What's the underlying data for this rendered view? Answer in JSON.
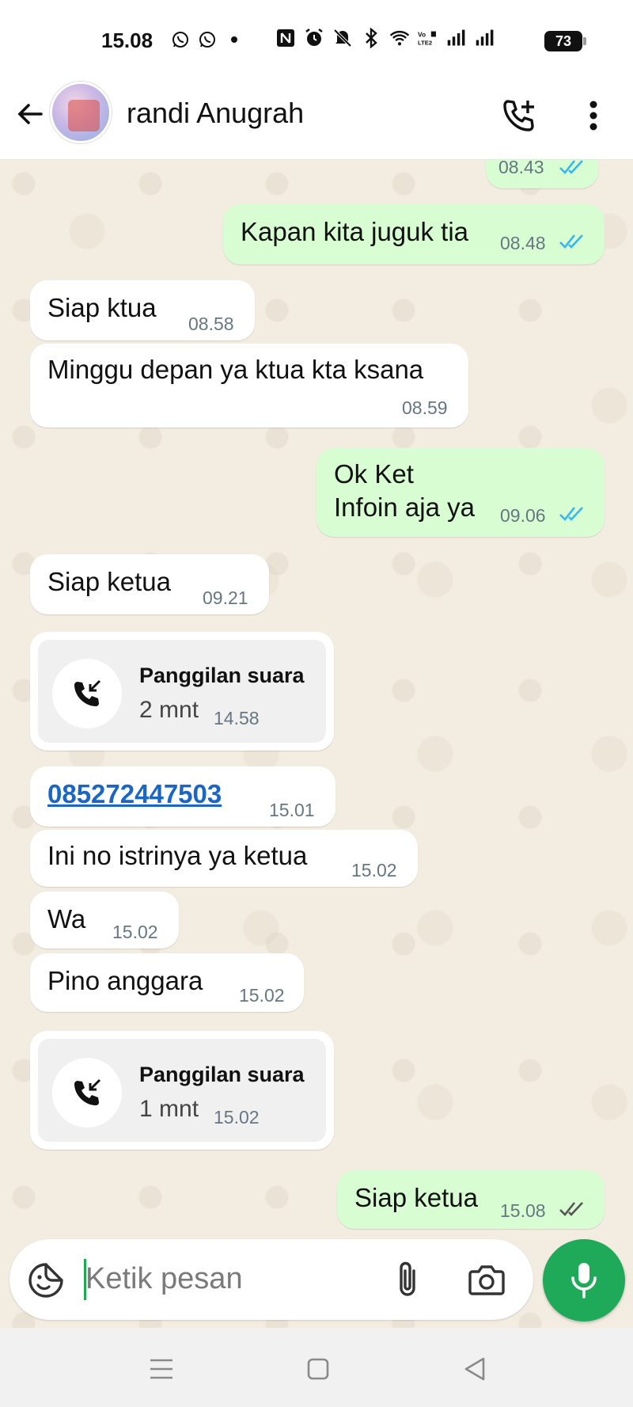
{
  "status_bar": {
    "time": "15.08",
    "battery": "73",
    "left_icons": [
      "whatsapp-icon",
      "whatsapp-icon",
      "dot-icon"
    ],
    "right_icons": [
      "nfc-icon",
      "alarm-icon",
      "mute-icon",
      "bluetooth-icon",
      "wifi-icon",
      "volte-icon",
      "signal-icon",
      "signal-icon"
    ]
  },
  "header": {
    "contact_name": "randi Anugrah",
    "icons": [
      "back-arrow-icon",
      "avatar",
      "add-call-icon",
      "more-vert-icon"
    ]
  },
  "messages": [
    {
      "dir": "out",
      "text": "",
      "time": "08.43",
      "read": true
    },
    {
      "dir": "out",
      "text": "Kapan kita juguk tia",
      "time": "08.48",
      "read": true
    },
    {
      "dir": "in",
      "text": "Siap ktua",
      "time": "08.58"
    },
    {
      "dir": "in",
      "text": "Minggu depan ya ktua kta ksana",
      "time": "08.59"
    },
    {
      "dir": "out",
      "text_line1": "Ok Ket",
      "text_line2": "Infoin aja ya",
      "time": "09.06",
      "read": true
    },
    {
      "dir": "in",
      "text": "Siap ketua",
      "time": "09.21"
    },
    {
      "dir": "in",
      "type": "call",
      "title": "Panggilan suara",
      "duration": "2 mnt",
      "time": "14.58"
    },
    {
      "dir": "in",
      "type": "link",
      "text": "085272447503",
      "time": "15.01"
    },
    {
      "dir": "in",
      "text": "Ini no istrinya ya ketua",
      "time": "15.02"
    },
    {
      "dir": "in",
      "text": "Wa",
      "time": "15.02"
    },
    {
      "dir": "in",
      "text": "Pino anggara",
      "time": "15.02"
    },
    {
      "dir": "in",
      "type": "call",
      "title": "Panggilan suara",
      "duration": "1 mnt",
      "time": "15.02"
    },
    {
      "dir": "out",
      "text": "Siap ketua",
      "time": "15.08",
      "read": false
    }
  ],
  "input": {
    "placeholder": "Ketik pesan",
    "icons": [
      "emoji-sticker-icon",
      "paperclip-icon",
      "camera-icon",
      "microphone-icon"
    ]
  },
  "nav": {
    "icons": [
      "menu-icon",
      "home-square-icon",
      "back-triangle-icon"
    ]
  },
  "colors": {
    "outgoing_bubble": "#d9fdd3",
    "incoming_bubble": "#ffffff",
    "read_ticks": "#34b7f1",
    "mic_button": "#1faa59",
    "link": "#1a66c7"
  }
}
